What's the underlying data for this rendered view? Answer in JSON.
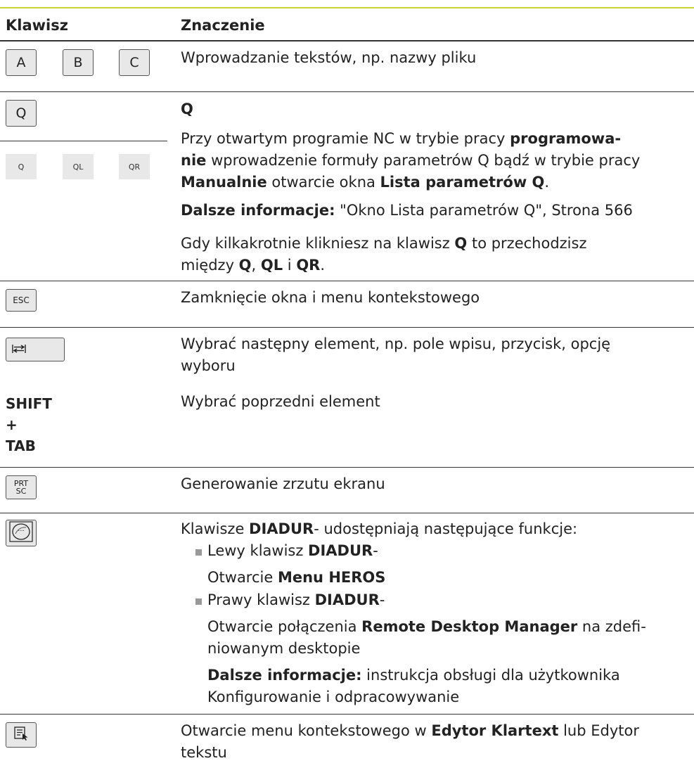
{
  "header": {
    "col1": "Klawisz",
    "col2": "Znaczenie"
  },
  "rows": {
    "abc": {
      "keys": [
        "A",
        "B",
        "C"
      ],
      "text": "Wprowadzanie tekstów, np. nazwy pliku"
    },
    "q": {
      "key": "Q",
      "softkeys": [
        "Q",
        "QL",
        "QR"
      ],
      "title": "Q",
      "p1": {
        "a": "Przy otwartym programie NC w trybie pracy ",
        "b": "programowa-",
        "c": "nie",
        "d": " wprowadzenie formuły parametrów Q bądź w trybie pracy",
        "e": "Manualnie",
        "f": " otwarcie okna ",
        "g": "Lista parametrów Q",
        "h": "."
      },
      "info": {
        "label": "Dalsze informacje:",
        "text": " \"Okno Lista parametrów Q\", Strona 566"
      },
      "p2": {
        "a": "Gdy kilkakrotnie klikniesz na klawisz ",
        "b": "Q",
        "c": " to przechodzisz",
        "d": "między ",
        "e": "Q",
        "f": ", ",
        "g": "QL",
        "h": " i ",
        "i": "QR",
        "j": "."
      }
    },
    "esc": {
      "key": "ESC",
      "text": "Zamknięcie okna i menu kontekstowego"
    },
    "tab": {
      "icon": "tab-arrows-icon",
      "line1": "Wybrać następny element, np. pole wpisu, przycisk, opcję",
      "line2": "wyboru"
    },
    "shift_tab": {
      "label1": "SHIFT",
      "label2": "+",
      "label3": "TAB",
      "text": "Wybrać poprzedni element"
    },
    "prtsc": {
      "key_line1": "PRT",
      "key_line2": "SC",
      "text": "Generowanie zrzutu ekranu"
    },
    "diadur": {
      "icon": "diadur-icon",
      "intro_a": "Klawisze ",
      "intro_b": "DIADUR",
      "intro_c": "- udostępniają następujące funkcje:",
      "left_a": "Lewy klawisz ",
      "left_b": "DIADUR",
      "left_c": "-",
      "left_open_a": "Otwarcie ",
      "left_open_b": "Menu HEROS",
      "right_a": "Prawy klawisz ",
      "right_b": "DIADUR",
      "right_c": "-",
      "right_open_a": "Otwarcie połączenia ",
      "right_open_b": "Remote Desktop Manager",
      "right_open_c": " na zdefi-",
      "right_open_d": "niowanym desktopie",
      "info_label": "Dalsze informacje:",
      "info_text": " instrukcja obsługi dla użytkownika",
      "info_text2": "Konfigurowanie i odpracowywanie"
    },
    "context": {
      "icon": "context-menu-icon",
      "a": "Otwarcie menu kontekstowego w ",
      "b": "Edytor Klartext",
      "c": " lub Edytor",
      "d": "tekstu"
    }
  }
}
